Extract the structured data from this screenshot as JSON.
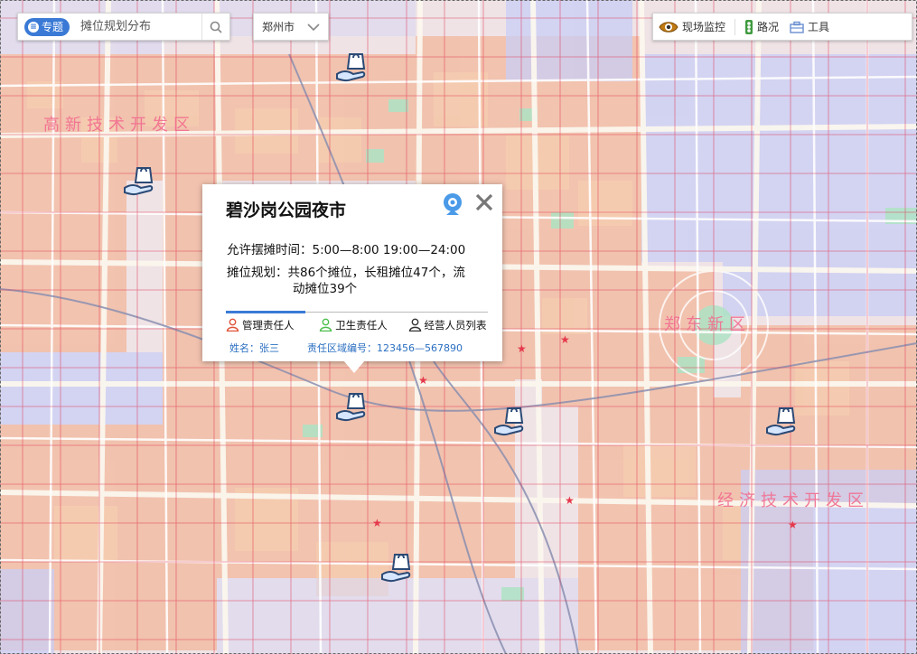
{
  "search": {
    "topic_label": "专题",
    "placeholder": "摊位规划分布"
  },
  "city_select": {
    "value": "郑州市"
  },
  "toolbar": {
    "monitor_label": "现场监控",
    "traffic_label": "路况",
    "tools_label": "工具"
  },
  "map": {
    "districts": [
      {
        "name": "高新技术开发区"
      },
      {
        "name": "郑东新区"
      },
      {
        "name": "经济技术开发区"
      }
    ],
    "markers": [
      {
        "name": "stall-1"
      },
      {
        "name": "stall-2"
      },
      {
        "name": "stall-3"
      },
      {
        "name": "stall-4"
      },
      {
        "name": "stall-5"
      },
      {
        "name": "stall-6"
      }
    ]
  },
  "popup": {
    "title": "碧沙岗公园夜市",
    "hours": "允许摆摊时间：5:00—8:00   19:00—24:00",
    "plan_a": "摊位规划：共86个摊位，长租摊位47个，流",
    "plan_b": "动摊位39个",
    "tabs": [
      {
        "label": "管理责任人",
        "color": "#e0523a"
      },
      {
        "label": "卫生责任人",
        "color": "#4cbf4c"
      },
      {
        "label": "经营人员列表",
        "color": "#333333"
      }
    ],
    "name_text": "姓名：张三",
    "area_text": "责任区域编号：123456—567890"
  },
  "colors": {
    "accent": "#3a7ad6",
    "district_text": "#f26d8f",
    "grid_line": "#e0304c"
  }
}
